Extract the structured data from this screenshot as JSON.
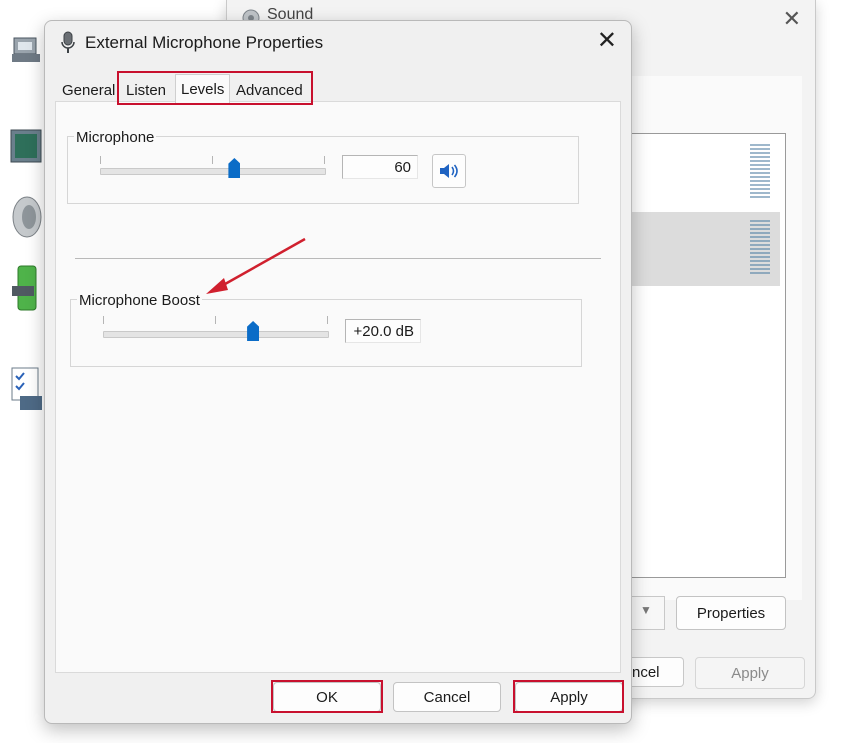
{
  "sound_window": {
    "title": "Sound",
    "close_glyph": "✕",
    "properties_label": "Properties",
    "cancel_label_partial": "ncel",
    "apply_label": "Apply"
  },
  "dialog": {
    "title": "External Microphone Properties",
    "close_glyph": "✕",
    "tabs": [
      {
        "label": "General"
      },
      {
        "label": "Listen"
      },
      {
        "label": "Levels"
      },
      {
        "label": "Advanced"
      }
    ],
    "active_tab": "Levels",
    "microphone": {
      "group_label": "Microphone",
      "value": "60",
      "level": 60
    },
    "boost": {
      "group_label": "Microphone Boost",
      "value": "+20.0 dB",
      "level_fraction": 0.67
    },
    "buttons": {
      "ok": "OK",
      "cancel": "Cancel",
      "apply": "Apply"
    }
  },
  "colors": {
    "annotation_red": "#c8102e",
    "slider_blue": "#0b6cc7"
  },
  "icons": [
    "microphone-icon",
    "speaker-icon",
    "close-icon",
    "chevron-down-icon"
  ]
}
